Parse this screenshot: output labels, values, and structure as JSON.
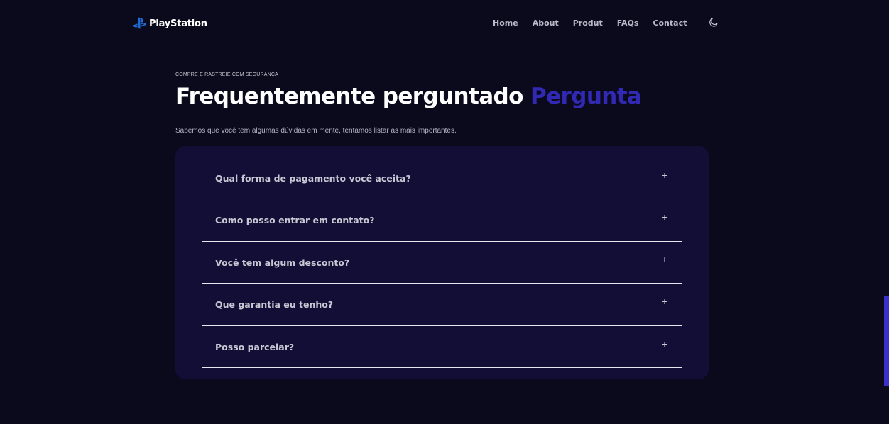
{
  "header": {
    "logo_text": "PlayStation",
    "nav": [
      "Home",
      "About",
      "Produt",
      "FAQs",
      "Contact"
    ],
    "theme_toggle_icon": "moon-icon"
  },
  "hero": {
    "eyebrow": "COMPRE E RASTREIE COM SEGURANÇA",
    "title_main": "Frequentemente perguntado ",
    "title_accent": "Pergunta",
    "subtitle": "Sabemos que você tem algumas dúvidas em mente, tentamos listar as mais importantes."
  },
  "faq": {
    "items": [
      {
        "question": "Qual forma de pagamento você aceita?",
        "icon": "+"
      },
      {
        "question": "Como posso entrar em contato?",
        "icon": "+"
      },
      {
        "question": "Você tem algum desconto?",
        "icon": "+"
      },
      {
        "question": "Que garantia eu tenho?",
        "icon": "+"
      },
      {
        "question": "Posso parcelar?",
        "icon": "+"
      }
    ]
  },
  "colors": {
    "background": "#0b0a1c",
    "card": "#120e36",
    "accent": "#3128b3",
    "logo_blue": "#1f6bd6"
  }
}
